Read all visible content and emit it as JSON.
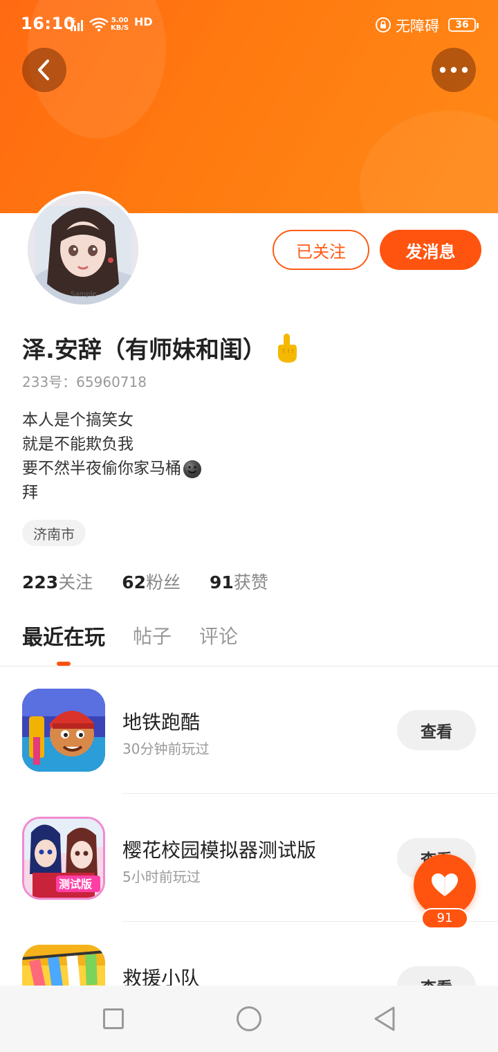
{
  "status_bar": {
    "time": "16:10",
    "network": "4G",
    "speed_value": "5.00",
    "speed_unit": "KB/S",
    "hd": "HD",
    "accessibility": "无障碍",
    "battery": "36"
  },
  "profile": {
    "name": "泽.安辞（有师妹和闺）",
    "name_emoji": "pointing-finger-emoji",
    "uid": "233号：65960718",
    "bio_lines": [
      "本人是个搞笑女",
      "就是不能欺负我",
      "要不然半夜偷你家马桶",
      "拜"
    ],
    "city": "济南市",
    "follow_button": "已关注",
    "message_button": "发消息",
    "avatar_watermark": "Sample"
  },
  "stats": {
    "following_count": "223",
    "following_label": "关注",
    "fans_count": "62",
    "fans_label": "粉丝",
    "likes_count": "91",
    "likes_label": "获赞"
  },
  "tabs": [
    {
      "label": "最近在玩",
      "active": true
    },
    {
      "label": "帖子",
      "active": false
    },
    {
      "label": "评论",
      "active": false
    }
  ],
  "recent_games": [
    {
      "name": "地铁跑酷",
      "time": "30分钟前玩过",
      "button": "查看"
    },
    {
      "name": "樱花校园模拟器测试版",
      "time": "5小时前玩过",
      "button": "查看",
      "icon_badge": "测试版"
    },
    {
      "name": "救援小队",
      "time": "",
      "button": "查看"
    }
  ],
  "like_fab": {
    "count": "91"
  },
  "colors": {
    "accent": "#ff5410",
    "banner": "#ff7a10"
  }
}
